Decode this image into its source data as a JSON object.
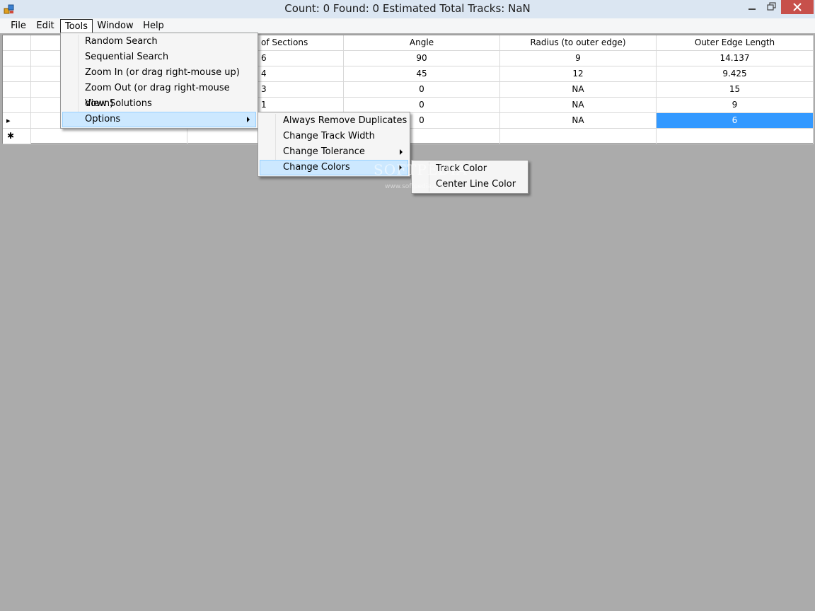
{
  "window": {
    "title": "Count: 0   Found: 0   Estimated Total Tracks: NaN",
    "app_icon": "app-icon",
    "controls": [
      "minimize-icon",
      "restore-icon",
      "close-icon"
    ]
  },
  "menubar": {
    "items": [
      {
        "label": "File"
      },
      {
        "label": "Edit"
      },
      {
        "label": "Tools"
      },
      {
        "label": "Window"
      },
      {
        "label": "Help"
      }
    ]
  },
  "grid": {
    "columns": [
      "",
      "",
      "of Sections",
      "Angle",
      "Radius (to outer edge)",
      "Outer Edge Length"
    ],
    "rows": [
      [
        "",
        "",
        "6",
        "90",
        "9",
        "14.137"
      ],
      [
        "",
        "",
        "4",
        "45",
        "12",
        "9.425"
      ],
      [
        "",
        "",
        "3",
        "0",
        "NA",
        "15"
      ],
      [
        "",
        "",
        "1",
        "0",
        "NA",
        "9"
      ],
      [
        "",
        "",
        "",
        "0",
        "NA",
        "6"
      ],
      [
        "",
        "",
        "",
        "",
        "",
        ""
      ]
    ],
    "current_row_marker": "▸",
    "new_row_marker": "✱",
    "selection_color": "#3399ff"
  },
  "tools_menu": {
    "items": [
      {
        "label": "Random Search"
      },
      {
        "label": "Sequential Search"
      },
      {
        "label": "Zoom In (or drag right-mouse up)"
      },
      {
        "label": "Zoom Out (or drag right-mouse down)"
      },
      {
        "label": "View Solutions"
      },
      {
        "label": "Options"
      }
    ]
  },
  "options_menu": {
    "items": [
      {
        "label": "Always Remove Duplicates"
      },
      {
        "label": "Change Track Width"
      },
      {
        "label": "Change Tolerance"
      },
      {
        "label": "Change Colors"
      }
    ]
  },
  "colors_menu": {
    "items": [
      {
        "label": "Track Color"
      },
      {
        "label": "Center Line Color"
      }
    ]
  },
  "watermark": {
    "text": "SOFTPEDIA",
    "url": "www.softpedia.com"
  }
}
